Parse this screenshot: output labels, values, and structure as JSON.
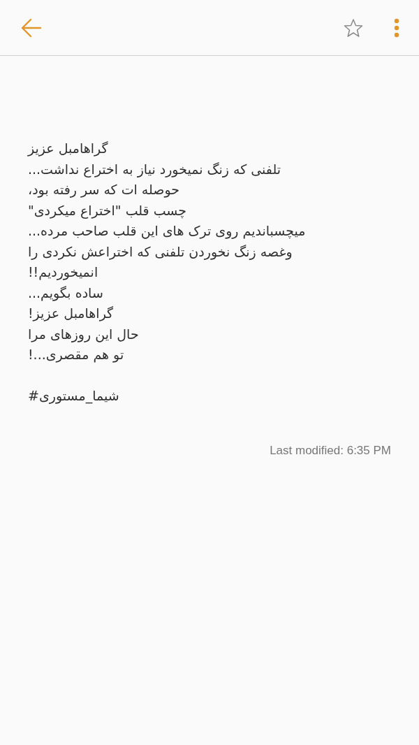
{
  "toolbar": {
    "favorite": false
  },
  "note": {
    "lines": [
      "گراهامبل عزیز",
      "تلفنی که زنگ نمیخورد نیاز به اختراع نداشت...",
      "حوصله ات که سر رفته بود،",
      "چسب قلب \"اختراع میکردی\"",
      "میچسباندیم روی ترک های این قلب صاحب مرده...",
      "وغصه زنگ نخوردن تلفنی که اختراعش نکردی را",
      "انمیخوردیم!!",
      "ساده بگویم...",
      "گراهامبل عزیز!",
      "حال این روزهای مرا",
      "تو هم مقصری...!"
    ],
    "tag": "شیما_مستوری#"
  },
  "last_modified": "Last modified: 6:35 PM"
}
